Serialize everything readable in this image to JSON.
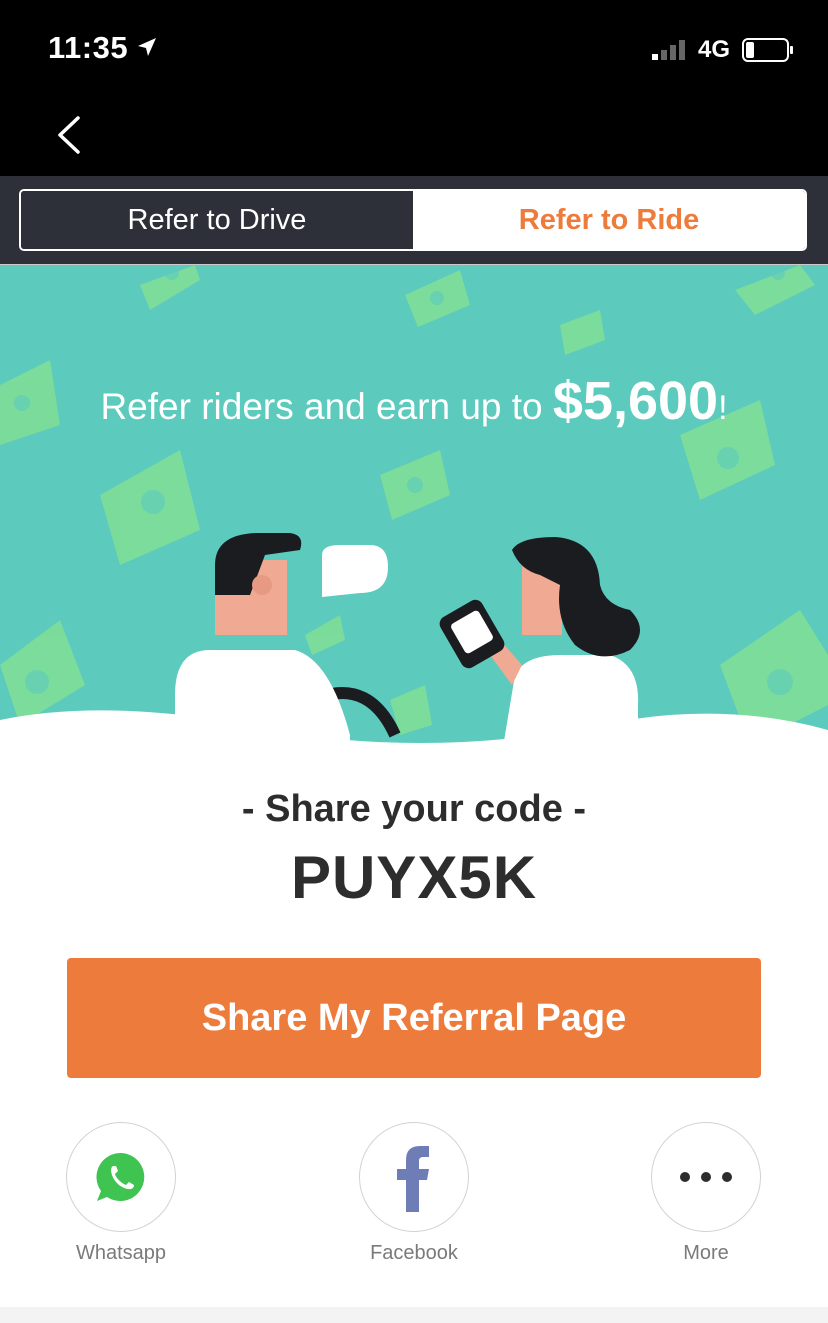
{
  "status_bar": {
    "time": "11:35",
    "network": "4G"
  },
  "tabs": [
    {
      "label": "Refer to Drive",
      "active": false
    },
    {
      "label": "Refer to Ride",
      "active": true
    }
  ],
  "hero": {
    "text": "Refer riders and earn up to ",
    "amount": "$5,600",
    "suffix": "!"
  },
  "share": {
    "label": "- Share your code -",
    "code": "PUYX5K"
  },
  "cta": {
    "label": "Share My Referral Page"
  },
  "share_options": [
    {
      "label": "Whatsapp",
      "icon": "whatsapp-icon"
    },
    {
      "label": "Facebook",
      "icon": "facebook-icon"
    },
    {
      "label": "More",
      "icon": "more-icon"
    }
  ],
  "colors": {
    "accent": "#ed7b3b",
    "hero_bg": "#5ccabd",
    "dark": "#2d3038"
  }
}
